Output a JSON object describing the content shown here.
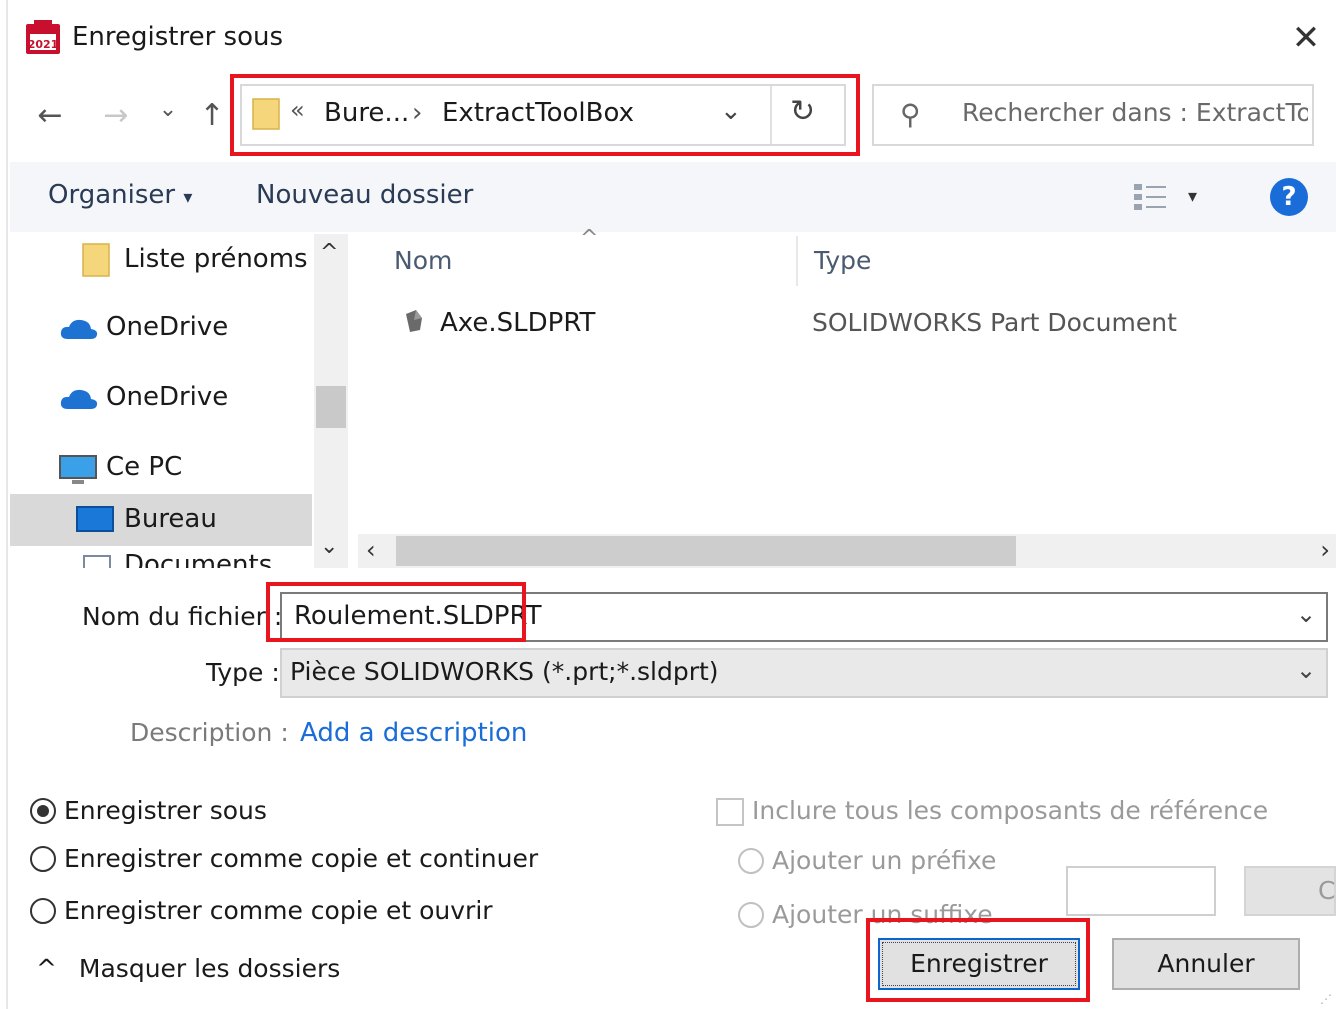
{
  "window": {
    "title": "Enregistrer sous",
    "close_glyph": "✕",
    "app_icon": "solidworks-app-icon"
  },
  "nav": {
    "back_glyph": "←",
    "forward_glyph": "→",
    "recent_glyph": "⌄",
    "up_glyph": "↑"
  },
  "address": {
    "overflow_glyph": "«",
    "segments": [
      "Bure...",
      "ExtractToolBox"
    ],
    "separator_glyph": "›",
    "dropdown_glyph": "⌄",
    "refresh_glyph": "↻"
  },
  "search": {
    "icon_glyph": "⚲",
    "placeholder": "Rechercher dans : ExtractToo..."
  },
  "toolbar": {
    "organize_label": "Organiser",
    "organize_caret": "▾",
    "new_folder_label": "Nouveau dossier",
    "view_caret": "▾",
    "help_label": "?"
  },
  "navpane": {
    "items": [
      {
        "label": "Liste prénoms",
        "icon": "folder-icon"
      },
      {
        "label": "OneDrive",
        "icon": "onedrive-cloud-icon"
      },
      {
        "label": "OneDrive",
        "icon": "onedrive-cloud-icon"
      },
      {
        "label": "Ce PC",
        "icon": "computer-icon"
      },
      {
        "label": "Bureau",
        "icon": "desktop-icon",
        "selected": true
      },
      {
        "label": "Documents",
        "icon": "documents-icon"
      }
    ],
    "scroll_up_glyph": "^",
    "scroll_down_glyph": "⌄"
  },
  "filelist": {
    "columns": [
      "Nom",
      "Type"
    ],
    "sort_glyph": "^",
    "rows": [
      {
        "name": "Axe.SLDPRT",
        "type": "SOLIDWORKS Part Document",
        "icon": "solidworks-part-icon"
      }
    ],
    "scroll_left_glyph": "‹",
    "scroll_right_glyph": "›"
  },
  "form": {
    "filename_label": "Nom du fichier :",
    "filename_value": "Roulement.SLDPRT",
    "type_label": "Type :",
    "type_value": "Pièce SOLIDWORKS (*.prt;*.sldprt)",
    "dropdown_glyph": "⌄",
    "description_label": "Description :",
    "description_link": "Add a description"
  },
  "options": {
    "save_modes": [
      {
        "label": "Enregistrer sous",
        "checked": true
      },
      {
        "label": "Enregistrer comme copie et continuer",
        "checked": false
      },
      {
        "label": "Enregistrer comme copie et ouvrir",
        "checked": false
      }
    ],
    "include_refs_label": "Inclure tous les composants de référence",
    "prefix_label": "Ajouter un préfixe",
    "suffix_label": "Ajouter un suffixe",
    "side_button_label": "C"
  },
  "footer": {
    "hide_folders_glyph": "^",
    "hide_folders_label": "Masquer les dossiers",
    "save_button": "Enregistrer",
    "cancel_button": "Annuler"
  },
  "colors": {
    "highlight_red": "#e8141e",
    "accent_blue": "#1a6dd8",
    "folder_yellow": "#f5d67a",
    "onedrive_blue": "#1e73d2"
  }
}
